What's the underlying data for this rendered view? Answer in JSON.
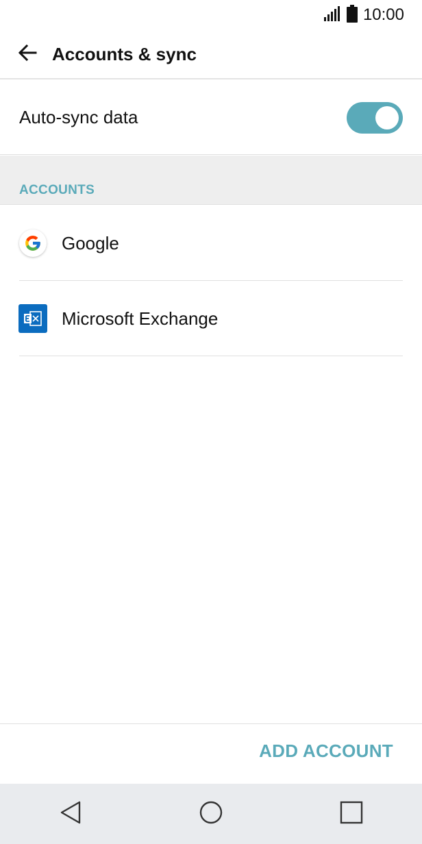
{
  "status_bar": {
    "time": "10:00",
    "signal_icon": "signal-icon",
    "battery_icon": "battery-icon"
  },
  "app_bar": {
    "back_icon": "arrow-back-icon",
    "title": "Accounts & sync"
  },
  "auto_sync": {
    "label": "Auto-sync data",
    "enabled": true,
    "accent_color": "#5aaab9"
  },
  "accounts_section": {
    "title": "ACCOUNTS",
    "items": [
      {
        "label": "Google",
        "icon": "google-icon"
      },
      {
        "label": "Microsoft Exchange",
        "icon": "exchange-icon"
      }
    ]
  },
  "footer": {
    "add_account_label": "ADD ACCOUNT"
  },
  "nav_bar": {
    "back": "nav-back-icon",
    "home": "nav-home-icon",
    "recents": "nav-recents-icon"
  }
}
